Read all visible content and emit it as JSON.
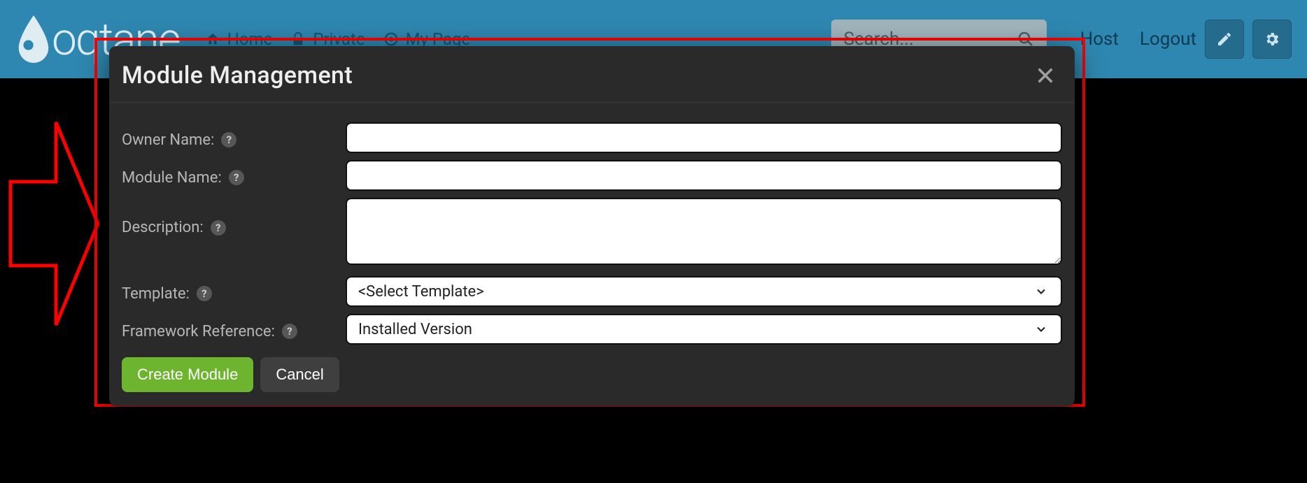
{
  "header": {
    "logo_text": "oqtane",
    "nav": {
      "home": "Home",
      "private": "Private",
      "mypage": "My Page"
    },
    "search_placeholder": "Search...",
    "host": "Host",
    "logout": "Logout"
  },
  "modal": {
    "title": "Module Management",
    "labels": {
      "owner": "Owner Name:",
      "module": "Module Name:",
      "description": "Description:",
      "template": "Template:",
      "framework": "Framework Reference:"
    },
    "values": {
      "owner": "",
      "module": "",
      "description": "",
      "template": "<Select Template>",
      "framework": "Installed Version"
    },
    "buttons": {
      "create": "Create Module",
      "cancel": "Cancel"
    },
    "help_glyph": "?"
  }
}
